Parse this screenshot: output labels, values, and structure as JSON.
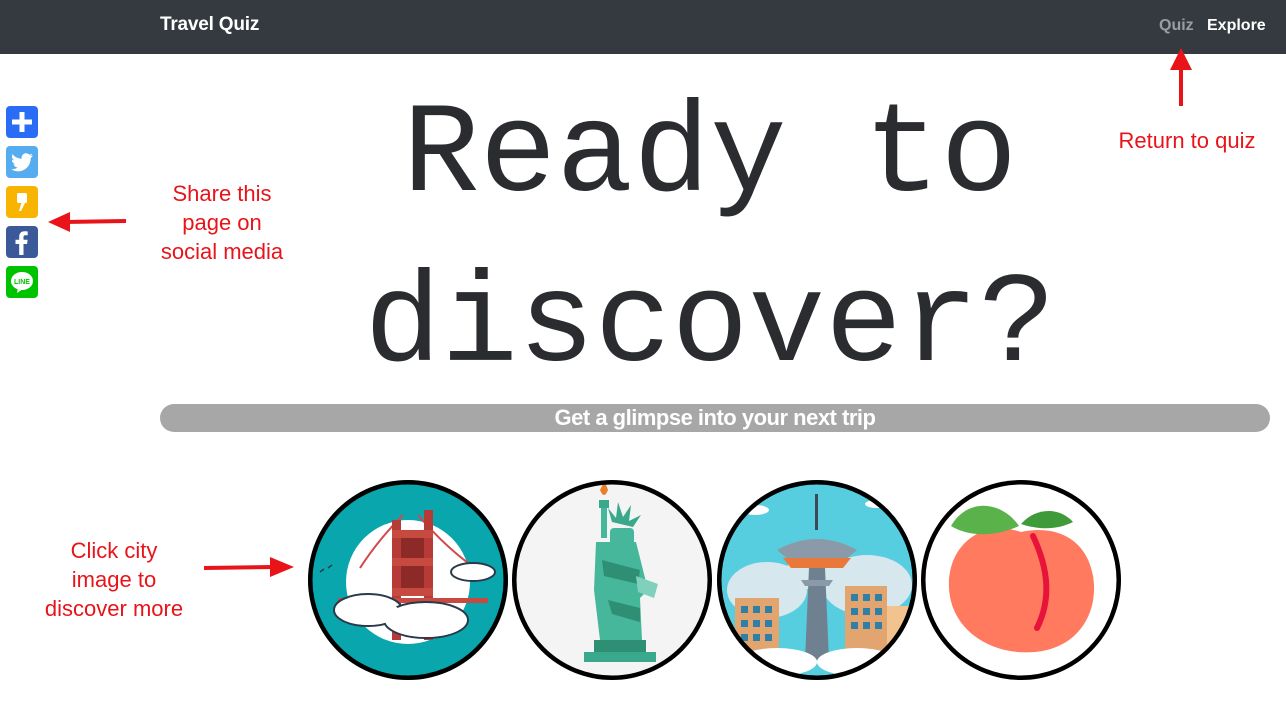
{
  "navbar": {
    "brand": "Travel Quiz",
    "links": [
      {
        "label": "Quiz",
        "active": false
      },
      {
        "label": "Explore",
        "active": true
      }
    ]
  },
  "share_buttons": [
    {
      "icon": "add-share-icon",
      "color": "#2b6cf6"
    },
    {
      "icon": "twitter-icon",
      "color": "#55acee"
    },
    {
      "icon": "kakao-story-icon",
      "color": "#f8b400"
    },
    {
      "icon": "facebook-icon",
      "color": "#3b5998"
    },
    {
      "icon": "line-icon",
      "color": "#00c300"
    }
  ],
  "headline": {
    "line1": "Ready to",
    "line2": "discover?"
  },
  "banner": "Get a glimpse into your next trip",
  "cities": [
    {
      "icon": "golden-gate-bridge-icon"
    },
    {
      "icon": "statue-of-liberty-icon"
    },
    {
      "icon": "space-needle-icon"
    },
    {
      "icon": "peach-icon"
    }
  ],
  "annotations": {
    "share": [
      "Share this",
      "page on",
      "social media"
    ],
    "quiz": "Return to quiz",
    "city": [
      "Click city",
      "image to",
      "discover more"
    ]
  },
  "colors": {
    "navbar": "#343a40",
    "banner": "#a7a7a7",
    "annotation": "#e8141a"
  }
}
